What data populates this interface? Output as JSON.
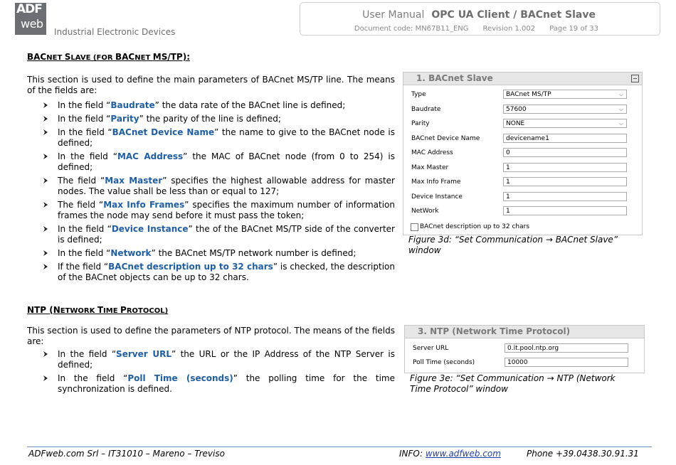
{
  "header": {
    "logo_top": "ADF",
    "logo_bottom": "web",
    "tagline": "Industrial Electronic Devices",
    "manual_label": "User Manual",
    "product": "OPC UA Client / BACnet Slave",
    "doc_code": "Document code: MN67B11_ENG",
    "revision": "Revision 1.002",
    "page": "Page 19 of 33"
  },
  "bacnet": {
    "heading_parts": [
      "BAC",
      "NET ",
      "S",
      "LAVE (",
      "FOR ",
      "BAC",
      "NET ",
      "MS/TP):"
    ],
    "intro": "This section is used to define the main parameters of BACnet MS/TP line. The means of the fields are:",
    "items": [
      {
        "pre": "In the field “",
        "kw": "Baudrate",
        "post": "” the data rate of the BACnet line is defined;"
      },
      {
        "pre": "In the field “",
        "kw": "Parity",
        "post": "” the parity of the line is defined;"
      },
      {
        "pre": "In the field “",
        "kw": "BACnet Device Name",
        "post": "” the name to give to the BACnet node is defined;"
      },
      {
        "pre": "In the field “",
        "kw": "MAC Address",
        "post": "” the MAC of BACnet node (from 0 to 254) is defined;"
      },
      {
        "pre": "The field “",
        "kw": "Max Master",
        "post": "” specifies the highest allowable address for master nodes. The value shall be less than or equal to 127;"
      },
      {
        "pre": "The field “",
        "kw": "Max Info Frames",
        "post": "” specifies the maximum number of information frames the node may send before it must pass the token;"
      },
      {
        "pre": "In the field “",
        "kw": "Device Instance",
        "post": "” the of the BACnet MS/TP side of the converter is defined;"
      },
      {
        "pre": "In the field “",
        "kw": "Network",
        "post": "” the BACnet MS/TP network number is defined;"
      },
      {
        "pre": "If the field “",
        "kw": "BACnet description up to 32 chars",
        "post": "” is checked, the description of the BACnet objects can be up to 32 chars."
      }
    ],
    "window": {
      "title": "1. BACnet Slave",
      "rows": [
        {
          "label": "Type",
          "value": "BACnet MS/TP",
          "select": true
        },
        {
          "label": "Baudrate",
          "value": "57600",
          "select": true
        },
        {
          "label": "Parity",
          "value": "NONE",
          "select": true
        },
        {
          "label": "BACnet Device Name",
          "value": "devicename1",
          "select": false
        },
        {
          "label": "MAC Address",
          "value": "0",
          "select": false
        },
        {
          "label": "Max Master",
          "value": "1",
          "select": false
        },
        {
          "label": "Max Info Frame",
          "value": "1",
          "select": false
        },
        {
          "label": "Device Instance",
          "value": "1",
          "select": false
        },
        {
          "label": "NetWork",
          "value": "1",
          "select": false
        }
      ],
      "checkbox_label": "BACnet description up to 32 chars",
      "checkbox_checked": false
    },
    "caption": "Figure 3d: “Set Communication → BACnet Slave” window"
  },
  "ntp": {
    "heading_parts": [
      "NTP (",
      "N",
      "ETWORK ",
      "T",
      "IME ",
      "P",
      "ROTOCOL)"
    ],
    "intro": "This section is used to define the parameters of NTP protocol. The means of the fields are:",
    "items": [
      {
        "pre": " In the field “",
        "kw": "Server URL",
        "post": "” the URL or the IP Address of the NTP Server is defined;"
      },
      {
        "pre": "In the field “",
        "kw": "Poll Time (seconds)",
        "post": "” the polling time for the time synchronization is defined."
      }
    ],
    "window": {
      "title": "3. NTP (Network Time Protocol)",
      "rows": [
        {
          "label": "Server URL",
          "value": "0.it.pool.ntp.org"
        },
        {
          "label": "Poll Time (seconds)",
          "value": "10000"
        }
      ]
    },
    "caption": "Figure 3e: “Set Communication → NTP (Network Time Protocol” window"
  },
  "footer": {
    "company": "ADFweb.com Srl – IT31010 – Mareno – Treviso",
    "info_label": "INFO: ",
    "website": "www.adfweb.com",
    "phone": "Phone +39.0438.30.91.31"
  },
  "colors": {
    "keyword": "#1f5ea8",
    "footer_rule": "#6f8fbf",
    "link": "#1f3fb5"
  }
}
